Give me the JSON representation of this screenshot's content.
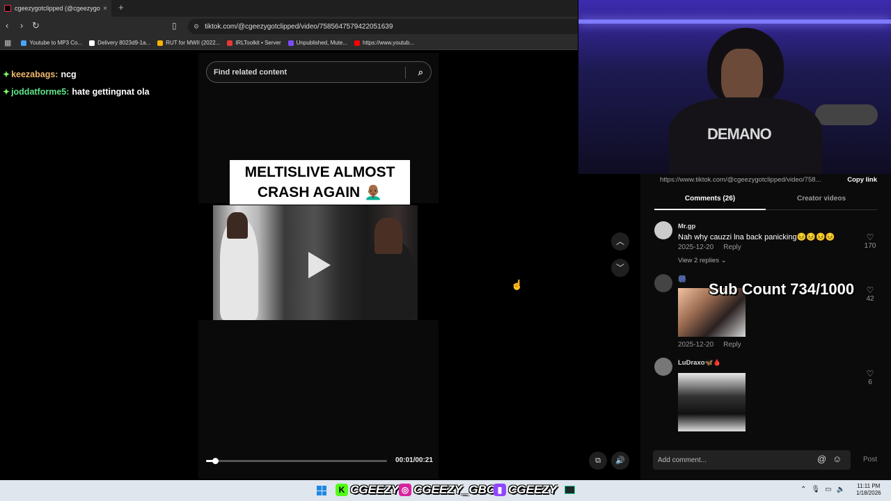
{
  "browser": {
    "tab_title": "cgeezygotclipped (@cgeezygot",
    "tab_close": "×",
    "new_tab": "+",
    "url": "tiktok.com/@cgeezygotclipped/video/7585647579422051639",
    "bookmarks": [
      {
        "label": "Youtube to MP3 Co...",
        "color": "#4aa3ff"
      },
      {
        "label": "Delivery 8023d9-1a...",
        "color": "#ffffff"
      },
      {
        "label": "RUT for MWII (2022...",
        "color": "#f4b400"
      },
      {
        "label": "IRLToolkit • Server",
        "color": "#e53935"
      },
      {
        "label": "Unpublished, Mute...",
        "color": "#7c4dff"
      },
      {
        "label": "https://www.youtub...",
        "color": "#ff0000"
      }
    ]
  },
  "chat": [
    {
      "user": "keezabags:",
      "message": "ncg"
    },
    {
      "user": "joddatforme5:",
      "message": "hate gettingnat ola"
    }
  ],
  "player": {
    "search_placeholder": "Find related content",
    "caption_line1": "MELTISLIVE ALMOST",
    "caption_line2": "CRASH AGAIN 👨🏾‍🦲",
    "time": "00:01/00:21",
    "progress": 0.05
  },
  "panel": {
    "share_url": "https://www.tiktok.com/@cgeezygotclipped/video/758...",
    "copy_link": "Copy link",
    "tab_comments": "Comments (26)",
    "tab_creator": "Creator videos",
    "comments": [
      {
        "user": "Mr.gp",
        "text": "Nah why cauzzi lna back panicking😣😣😣😣",
        "date": "2025-12-20",
        "reply": "Reply",
        "likes": "170",
        "replies": "View 2 replies ⌄"
      },
      {
        "user": "🎆",
        "text": "",
        "date": "2025-12-20",
        "reply": "Reply",
        "likes": "42"
      },
      {
        "user": "LuDraxo🦋🩸",
        "text": "",
        "date": "",
        "reply": "",
        "likes": "6"
      }
    ],
    "add_comment": "Add comment...",
    "post": "Post"
  },
  "overlay": {
    "sub_count": "Sub Count 734/1000",
    "hoodie_text": "DEMANO"
  },
  "taskbar": {
    "social1": "CGEEZY",
    "social2": "CGEEZY_GBC",
    "social3": "CGEEZY",
    "time": "11:11 PM",
    "date": "1/18/2026"
  }
}
